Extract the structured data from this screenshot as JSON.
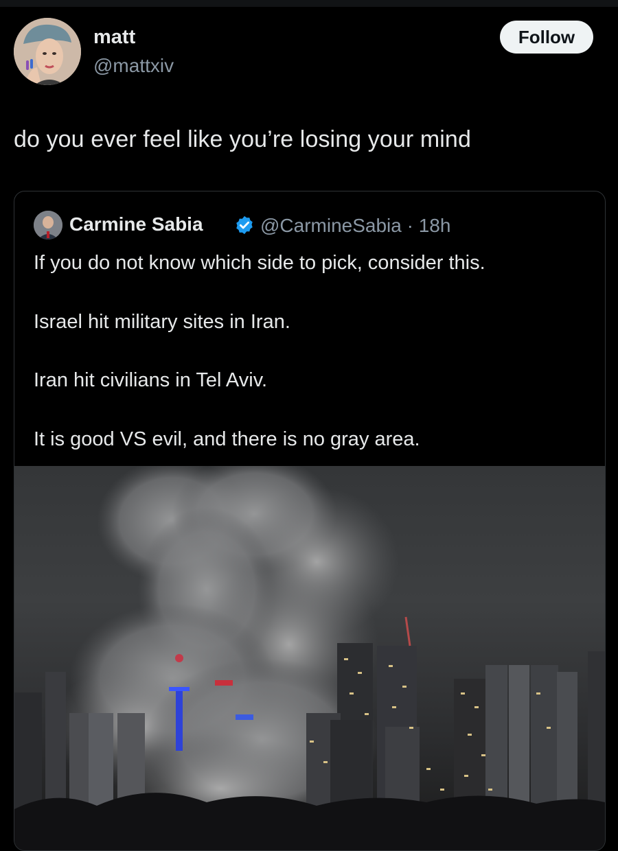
{
  "author": {
    "name": "matt",
    "handle": "@mattxiv",
    "follow_label": "Follow"
  },
  "tweet": {
    "text": "do you ever feel like you’re losing your mind"
  },
  "quoted_tweet": {
    "name": "Carmine Sabia",
    "handle_time": "@CarmineSabia · 18h",
    "lines": [
      "If you do not know which side to pick, consider this.",
      "Israel hit military sites in Iran.",
      "Iran hit civilians in Tel Aviv.",
      "It is good VS evil, and there is no gray area."
    ]
  },
  "icons": {
    "verified": "verified-badge-icon"
  },
  "colors": {
    "background": "#000000",
    "text_primary": "#e7e9ea",
    "text_secondary": "#8b98a5",
    "follow_button_bg": "#eff3f4",
    "verified_blue": "#1d9bf0",
    "card_border": "#2f3336"
  }
}
